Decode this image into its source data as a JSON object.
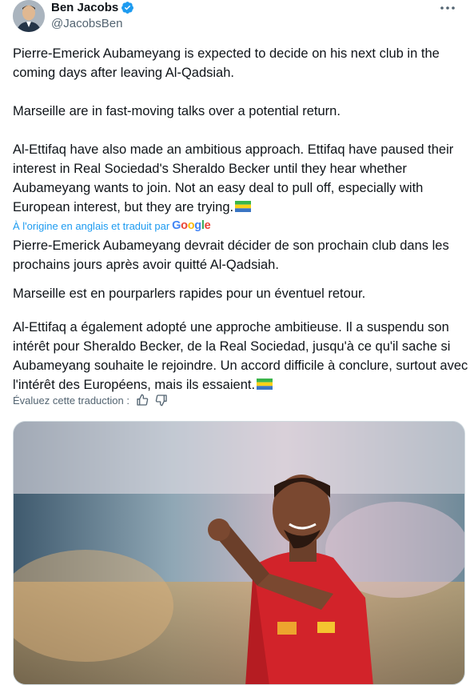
{
  "author": {
    "name": "Ben Jacobs",
    "handle": "@JacobsBen",
    "verified_icon": "verified-badge-icon"
  },
  "tweet": {
    "original_paragraphs": [
      "Pierre-Emerick Aubameyang is expected to decide on his next club in the coming days after leaving Al-Qadsiah.",
      "Marseille are in fast-moving talks over a potential return.",
      "Al-Ettifaq have also made an ambitious approach. Ettifaq have paused their interest in Real Sociedad's Sheraldo Becker until they hear whether Aubameyang wants to join. Not an easy deal to pull off, especially with European interest, but they are trying."
    ],
    "translation_notice": "À l'origine en anglais et traduit par",
    "translation_provider": "Google",
    "translated_paragraphs": [
      "Pierre-Emerick Aubameyang devrait décider de son prochain club dans les prochains jours après avoir quitté Al-Qadsiah.",
      "Marseille est en pourparlers rapides pour un éventuel retour.",
      "Al-Ettifaq a également adopté une approche ambitieuse. Il a suspendu son intérêt pour Sheraldo Becker, de la Real Sociedad, jusqu'à ce qu'il sache si Aubameyang souhaite le rejoindre. Un accord difficile à conclure, surtout avec l'intérêt des Européens, mais ils essaient."
    ],
    "rate_translation": "Évaluez cette traduction :",
    "flag_emoji": "gabon-flag"
  },
  "colors": {
    "text": "#0f1419",
    "secondary": "#536471",
    "link": "#1d9bf0",
    "verified": "#1d9bf0",
    "jersey": "#d2232a"
  }
}
